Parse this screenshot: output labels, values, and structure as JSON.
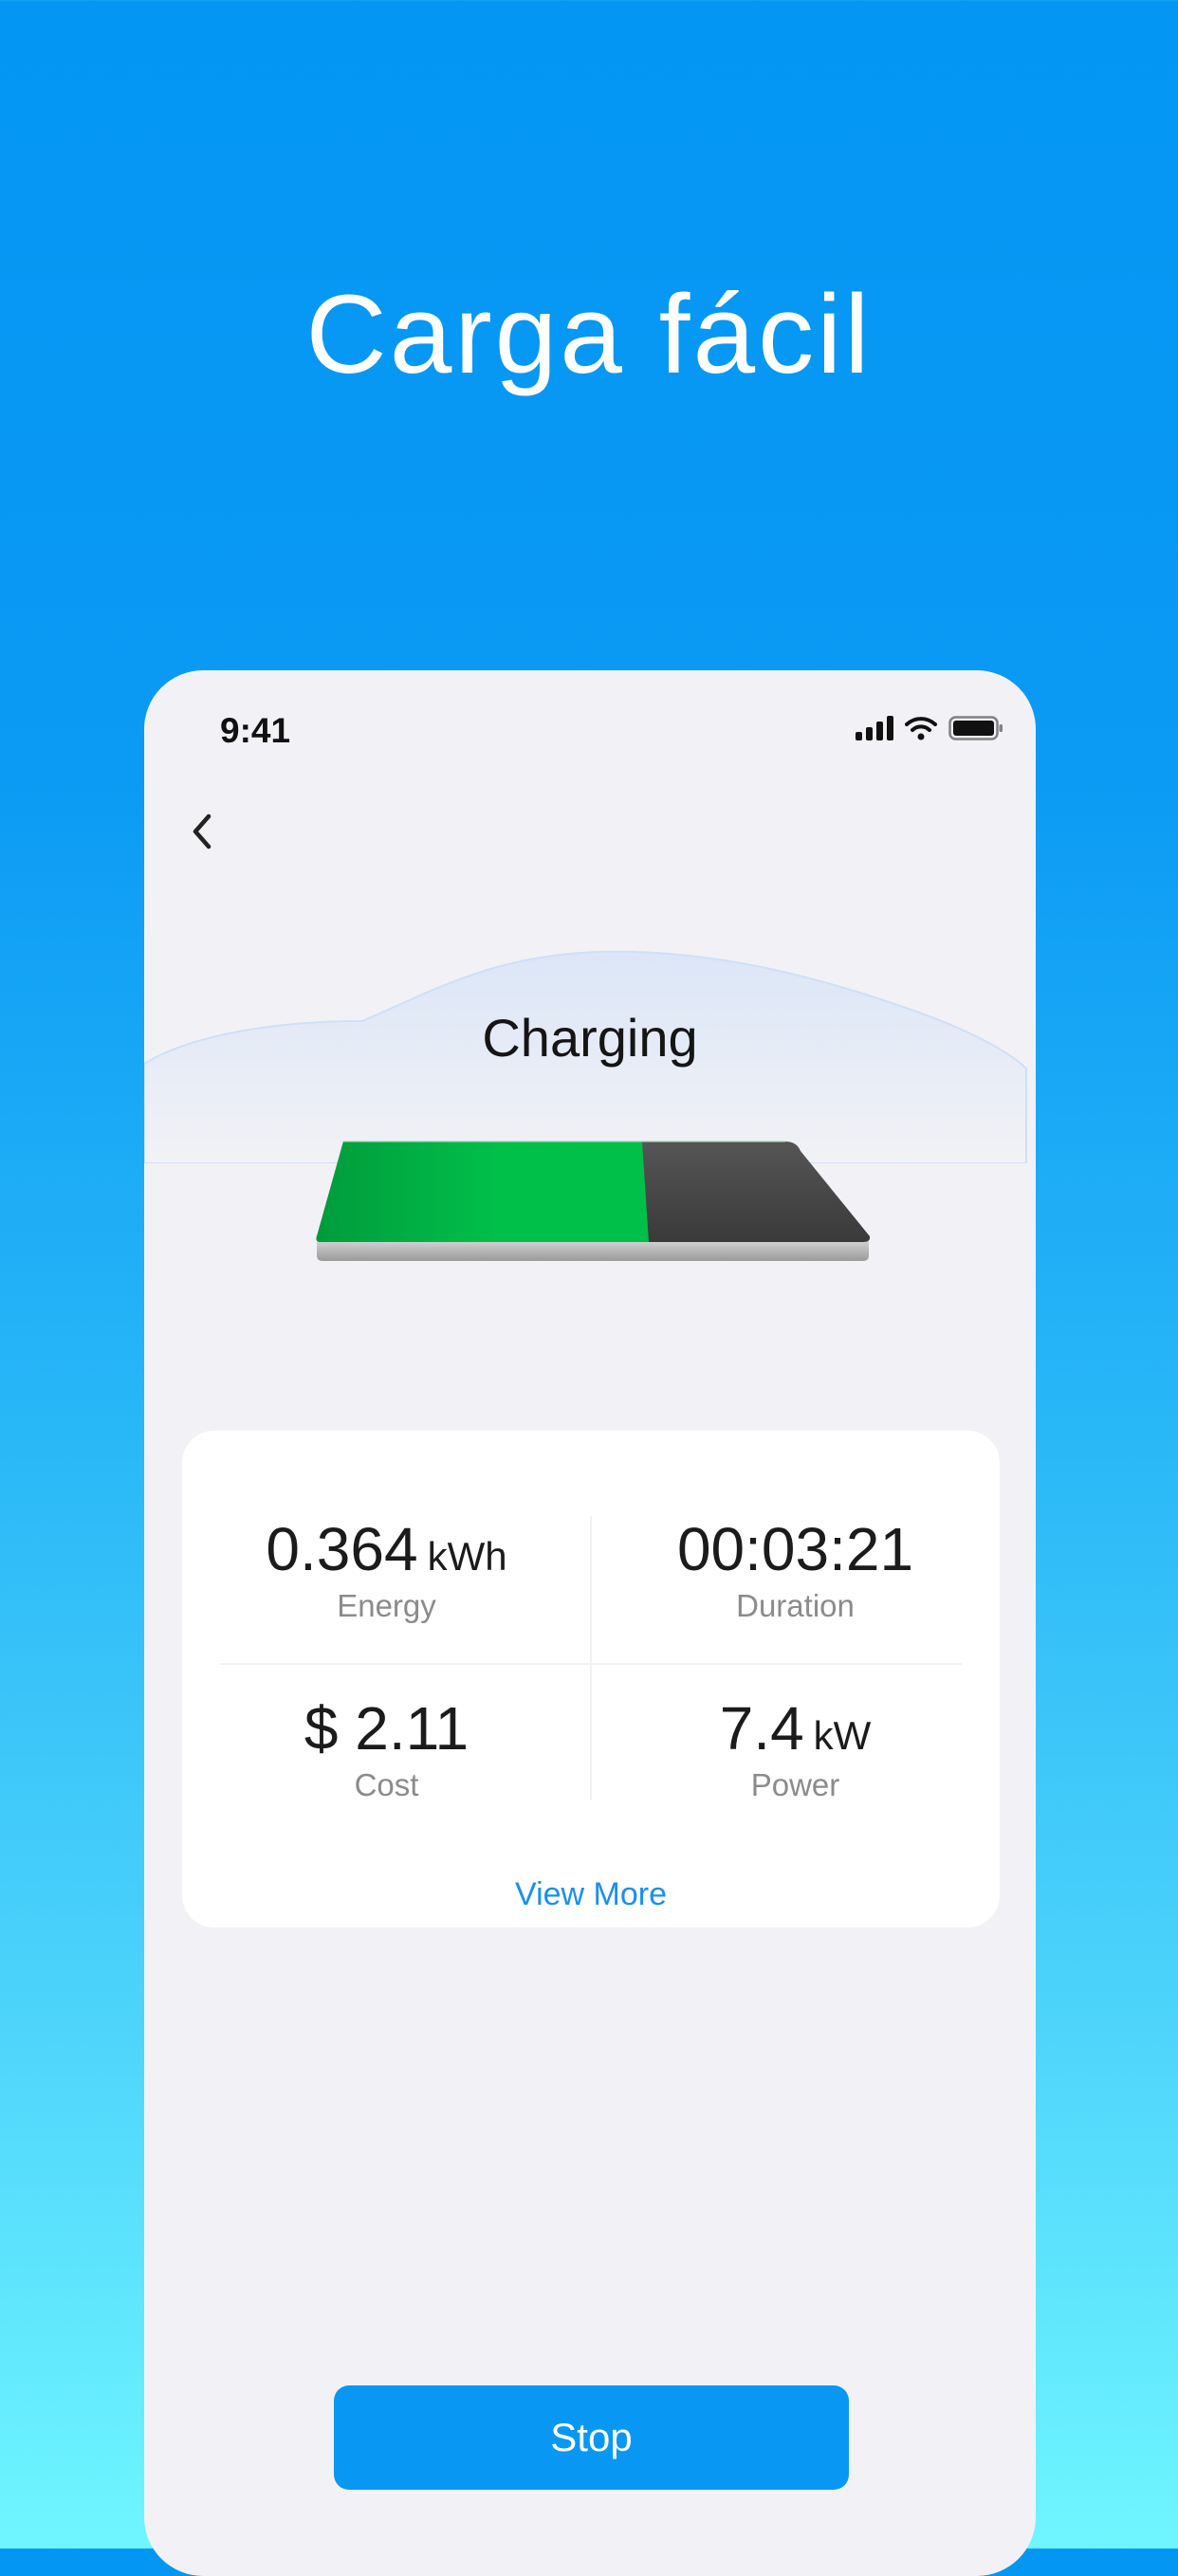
{
  "headline": "Carga fácil",
  "status_bar": {
    "time": "9:41",
    "icons": [
      "signal-icon",
      "wifi-icon",
      "battery-icon"
    ]
  },
  "nav": {
    "back_icon": "chevron-left-icon"
  },
  "screen": {
    "title": "Charging"
  },
  "battery_graphic": {
    "charge_fraction": 0.6,
    "fill_color": "#00c04a",
    "empty_color": "#4a4a4a"
  },
  "stats": {
    "energy": {
      "value": "0.364",
      "unit": "kWh",
      "label": "Energy"
    },
    "duration": {
      "value": "00:03:21",
      "label": "Duration"
    },
    "cost": {
      "value": "$ 2.11",
      "label": "Cost"
    },
    "power": {
      "value": "7.4",
      "unit": "kW",
      "label": "Power"
    }
  },
  "view_more_label": "View More",
  "stop_label": "Stop",
  "colors": {
    "accent": "#0898f4",
    "link": "#1a8ff0",
    "background_top": "#0396f3",
    "background_bottom": "#6ff6ff"
  }
}
